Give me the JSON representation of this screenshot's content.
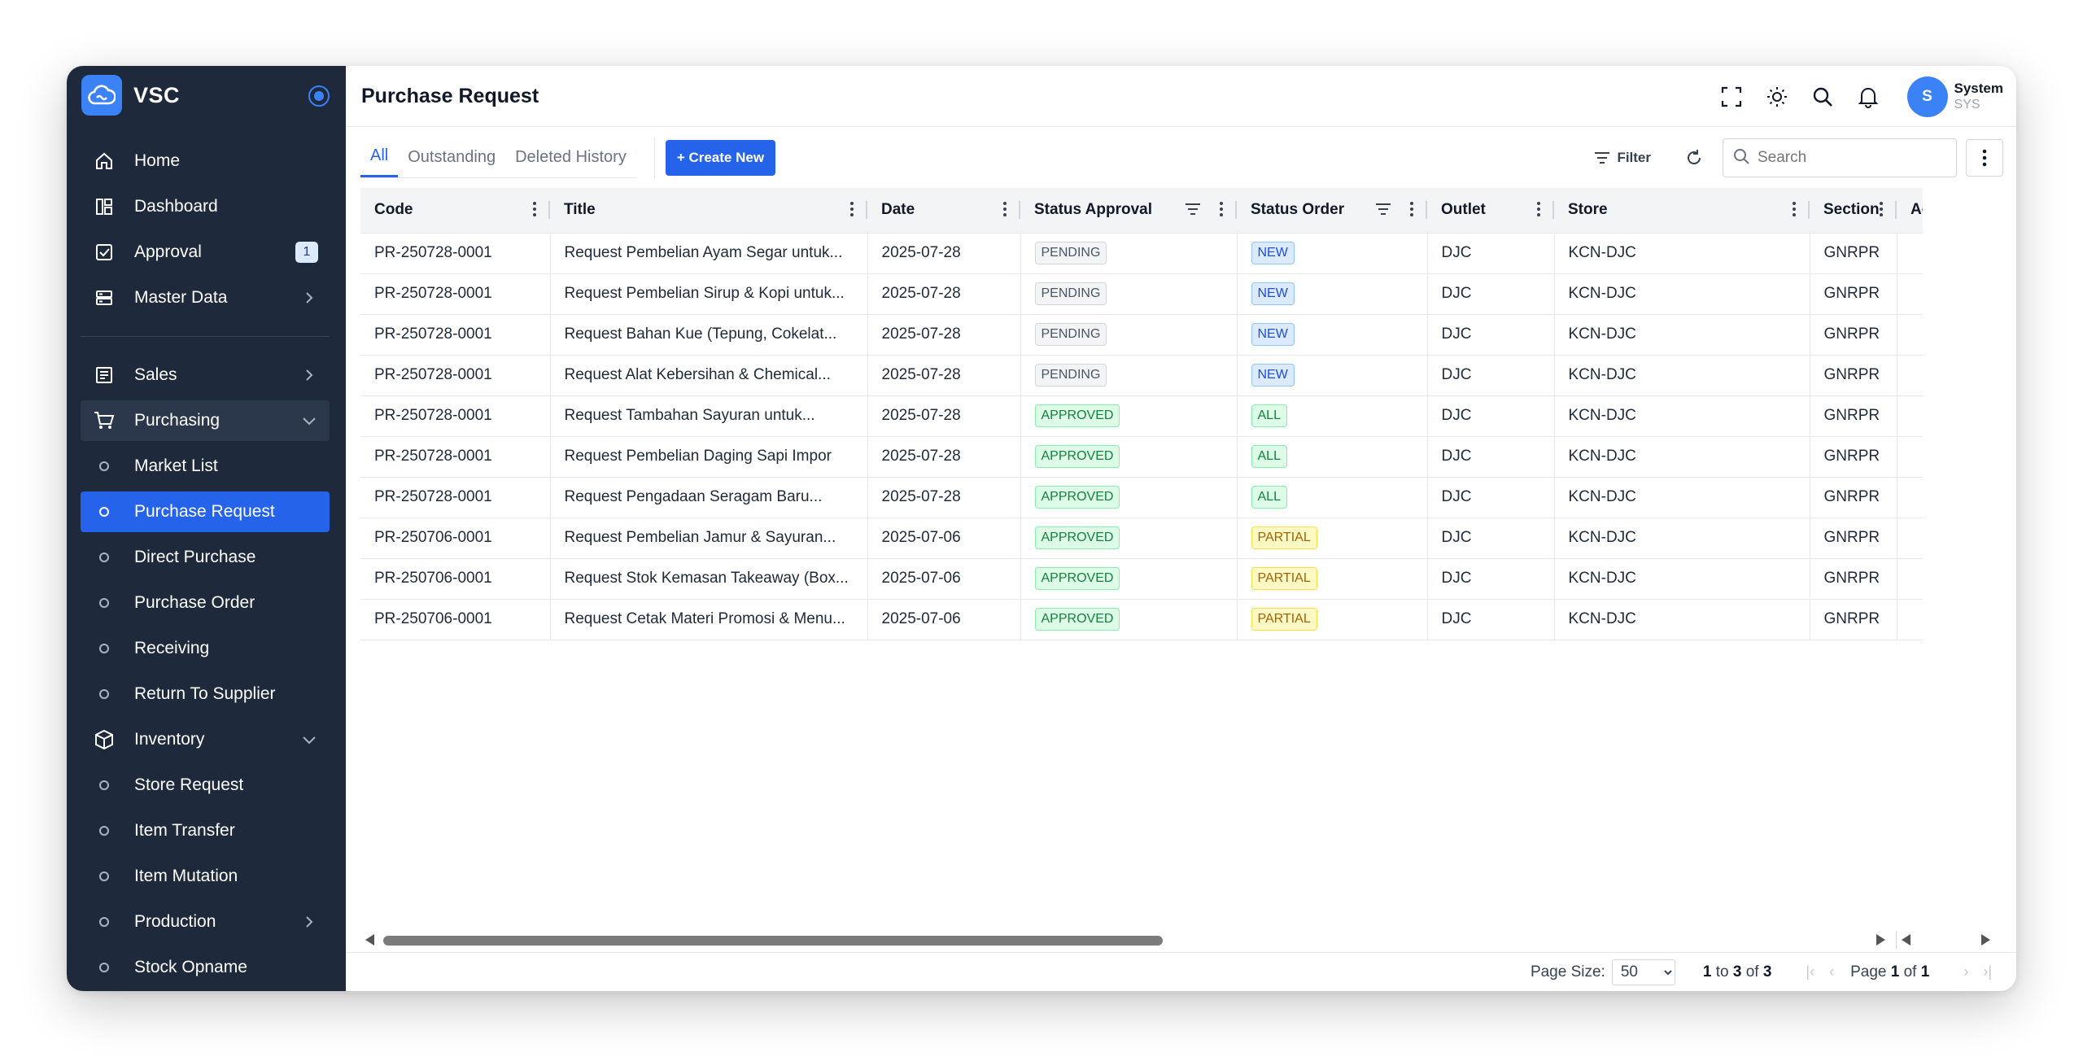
{
  "brand": {
    "name": "VSC"
  },
  "sidebar": {
    "items": [
      {
        "label": "Home",
        "icon": "home-icon"
      },
      {
        "label": "Dashboard",
        "icon": "dashboard-icon"
      },
      {
        "label": "Approval",
        "icon": "approval-icon",
        "badge": "1"
      },
      {
        "label": "Master Data",
        "icon": "database-icon"
      },
      {
        "label": "Sales",
        "icon": "sales-icon"
      },
      {
        "label": "Purchasing",
        "icon": "cart-icon"
      },
      {
        "label": "Market List"
      },
      {
        "label": "Purchase Request"
      },
      {
        "label": "Direct Purchase"
      },
      {
        "label": "Purchase Order"
      },
      {
        "label": "Receiving"
      },
      {
        "label": "Return To Supplier"
      },
      {
        "label": "Inventory",
        "icon": "box-icon"
      },
      {
        "label": "Store Request"
      },
      {
        "label": "Item Transfer"
      },
      {
        "label": "Item Mutation"
      },
      {
        "label": "Production"
      },
      {
        "label": "Stock Opname"
      }
    ]
  },
  "header": {
    "title": "Purchase Request"
  },
  "user": {
    "initial": "S",
    "name": "System",
    "code": "SYS"
  },
  "toolbar": {
    "tabs": [
      "All",
      "Outstanding",
      "Deleted History"
    ],
    "create_label": "+ Create New",
    "filter_label": "Filter",
    "search_placeholder": "Search"
  },
  "table": {
    "columns": [
      "Code",
      "Title",
      "Date",
      "Status Approval",
      "Status Order",
      "Outlet",
      "Store",
      "Section",
      "Action"
    ],
    "rows": [
      [
        "PR-250728-0001",
        "Request Pembelian Ayam Segar untuk...",
        "2025-07-28",
        "PENDING",
        "NEW",
        "DJC",
        "KCN-DJC",
        "GNRPR"
      ],
      [
        "PR-250728-0001",
        "Request Pembelian Sirup & Kopi untuk...",
        "2025-07-28",
        "PENDING",
        "NEW",
        "DJC",
        "KCN-DJC",
        "GNRPR"
      ],
      [
        "PR-250728-0001",
        "Request Bahan Kue (Tepung, Cokelat...",
        "2025-07-28",
        "PENDING",
        "NEW",
        "DJC",
        "KCN-DJC",
        "GNRPR"
      ],
      [
        "PR-250728-0001",
        "Request Alat Kebersihan & Chemical...",
        "2025-07-28",
        "PENDING",
        "NEW",
        "DJC",
        "KCN-DJC",
        "GNRPR"
      ],
      [
        "PR-250728-0001",
        "Request Tambahan Sayuran untuk...",
        "2025-07-28",
        "APPROVED",
        "ALL",
        "DJC",
        "KCN-DJC",
        "GNRPR"
      ],
      [
        "PR-250728-0001",
        "Request Pembelian Daging Sapi Impor",
        "2025-07-28",
        "APPROVED",
        "ALL",
        "DJC",
        "KCN-DJC",
        "GNRPR"
      ],
      [
        "PR-250728-0001",
        "Request Pengadaan Seragam Baru...",
        "2025-07-28",
        "APPROVED",
        "ALL",
        "DJC",
        "KCN-DJC",
        "GNRPR"
      ],
      [
        "PR-250706-0001",
        "Request Pembelian Jamur & Sayuran...",
        "2025-07-06",
        "APPROVED",
        "PARTIAL",
        "DJC",
        "KCN-DJC",
        "GNRPR"
      ],
      [
        "PR-250706-0001",
        "Request Stok Kemasan Takeaway (Box...",
        "2025-07-06",
        "APPROVED",
        "PARTIAL",
        "DJC",
        "KCN-DJC",
        "GNRPR"
      ],
      [
        "PR-250706-0001",
        "Request Cetak Materi Promosi & Menu...",
        "2025-07-06",
        "APPROVED",
        "PARTIAL",
        "DJC",
        "KCN-DJC",
        "GNRPR"
      ]
    ]
  },
  "pager": {
    "page_size_label": "Page Size:",
    "page_size": "50",
    "range_from": "1",
    "range_to_word": "to",
    "range_to": "3",
    "range_of_word": "of",
    "range_total": "3",
    "page_word": "Page",
    "page_current": "1",
    "page_of_word": "of",
    "page_total": "1"
  },
  "colors": {
    "sidebar_bg": "#1e2a3b",
    "accent": "#2563eb"
  }
}
